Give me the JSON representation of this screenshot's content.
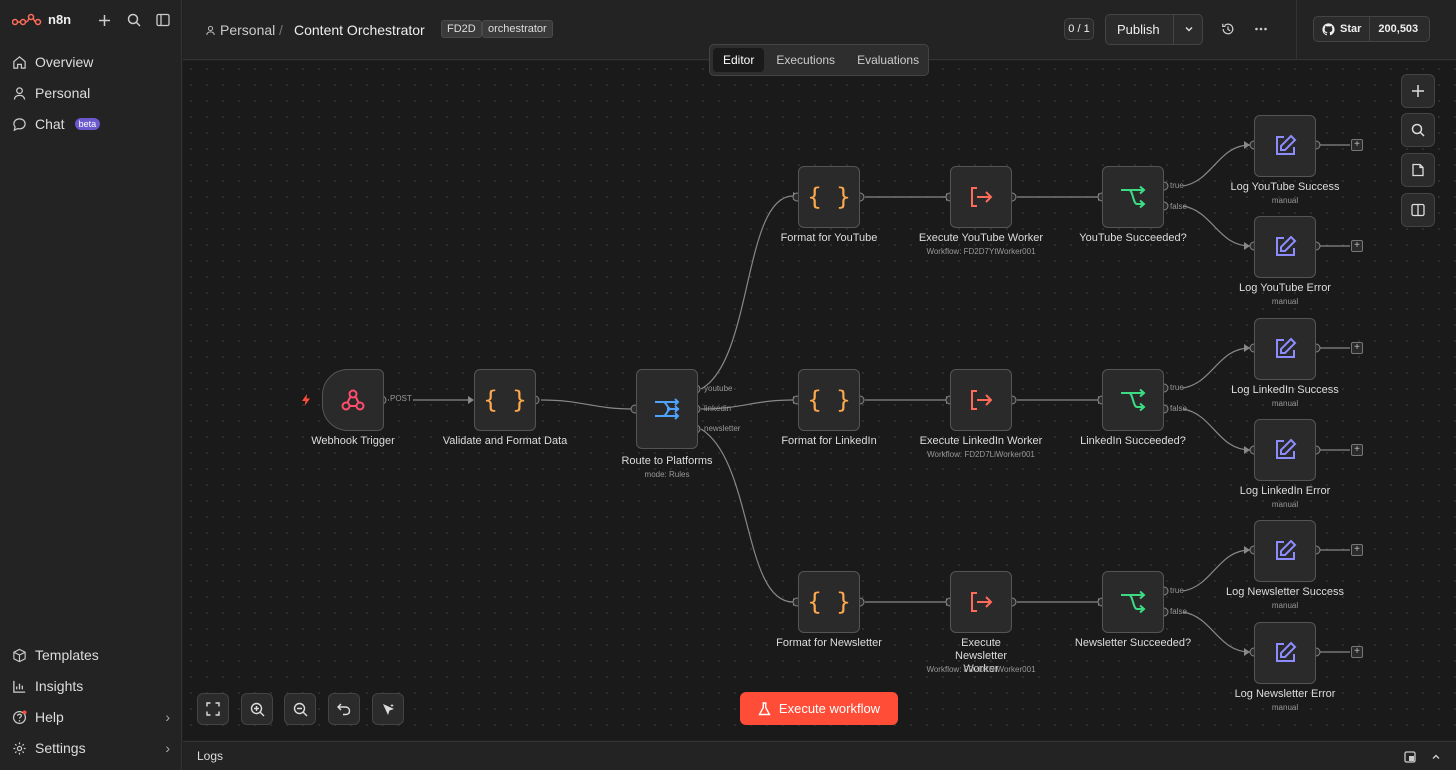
{
  "sidebar": {
    "brand": "n8n",
    "nav": [
      {
        "label": "Overview",
        "icon": "home-icon"
      },
      {
        "label": "Personal",
        "icon": "user-icon"
      },
      {
        "label": "Chat",
        "icon": "chat-icon",
        "badge": "beta"
      }
    ],
    "bottom_nav": [
      {
        "label": "Templates",
        "icon": "package-icon"
      },
      {
        "label": "Insights",
        "icon": "chart-icon"
      },
      {
        "label": "Help",
        "icon": "help-icon"
      },
      {
        "label": "Settings",
        "icon": "gear-icon"
      }
    ]
  },
  "header": {
    "breadcrumb_project": "Personal",
    "breadcrumb_separator": "/",
    "workflow_name": "Content Orchestrator",
    "tags": [
      "FD2D",
      "orchestrator"
    ],
    "version_counter": "0 / 1",
    "publish_label": "Publish",
    "github_star_label": "Star",
    "github_star_count": "200,503"
  },
  "tabs": [
    {
      "label": "Editor",
      "active": true
    },
    {
      "label": "Executions",
      "active": false
    },
    {
      "label": "Evaluations",
      "active": false
    }
  ],
  "nodes": {
    "webhook": {
      "label": "Webhook Trigger",
      "edge": "POST"
    },
    "validate": {
      "label": "Validate and Format Data"
    },
    "router": {
      "label": "Route to Platforms",
      "sub": "mode: Rules",
      "outputs": [
        "youtube",
        "linkedin",
        "newsletter"
      ]
    },
    "fmt_yt": {
      "label": "Format for YouTube"
    },
    "fmt_li": {
      "label": "Format for LinkedIn"
    },
    "fmt_nl": {
      "label": "Format for Newsletter"
    },
    "exec_yt": {
      "label": "Execute YouTube Worker",
      "sub": "Workflow: FD2D7YtWorker001"
    },
    "exec_li": {
      "label": "Execute LinkedIn Worker",
      "sub": "Workflow: FD2D7LiWorker001"
    },
    "exec_nl": {
      "label": "Execute Newsletter Worker",
      "sub": "Workflow: FD2D7NlWorker001"
    },
    "if_yt": {
      "label": "YouTube Succeeded?"
    },
    "if_li": {
      "label": "LinkedIn Succeeded?"
    },
    "if_nl": {
      "label": "Newsletter Succeeded?"
    },
    "branch_true": "true",
    "branch_false": "false",
    "log_yt_ok": {
      "label": "Log YouTube Success",
      "sub": "manual"
    },
    "log_yt_err": {
      "label": "Log YouTube Error",
      "sub": "manual"
    },
    "log_li_ok": {
      "label": "Log LinkedIn Success",
      "sub": "manual"
    },
    "log_li_err": {
      "label": "Log LinkedIn Error",
      "sub": "manual"
    },
    "log_nl_ok": {
      "label": "Log Newsletter Success",
      "sub": "manual"
    },
    "log_nl_err": {
      "label": "Log Newsletter Error",
      "sub": "manual"
    }
  },
  "execute_label": "Execute workflow",
  "logs_label": "Logs",
  "colors": {
    "accent": "#ff4d38",
    "code_icon": "#ffa94d",
    "exec_icon": "#ff6b5a",
    "if_icon": "#3ddc84",
    "router_icon": "#4da3ff",
    "edit_icon": "#8c8cff",
    "webhook_icon": "#ff4d6d"
  }
}
